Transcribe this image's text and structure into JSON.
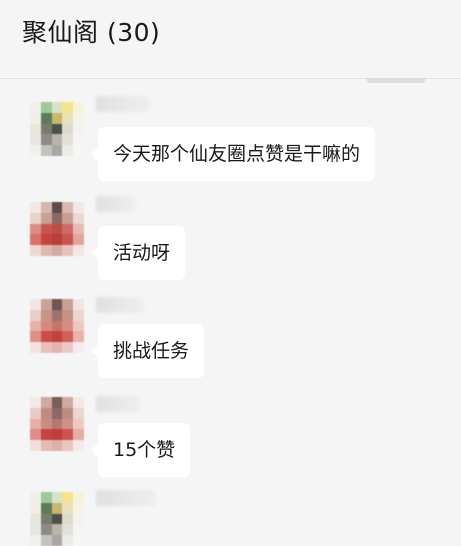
{
  "chat": {
    "title": "聚仙阁 (30)"
  },
  "messages": [
    {
      "text": "今天那个仙友圈点赞是干嘛的",
      "avatar_colors": [
        "#f0f0e8",
        "#9ec99a",
        "#d8e2c8",
        "#f4e48a",
        "#f7f3d8",
        "#f0efe6",
        "#5c7c58",
        "#c9b76c",
        "#e8e2bc",
        "#f5f3e8",
        "#e9e6dc",
        "#7a7b6e",
        "#4c4f4a",
        "#dedad0",
        "#f3f2ee",
        "#e6e6e0",
        "#8d8b84",
        "#b8b4aa",
        "#e2e0da",
        "#f4f4f2",
        "#f0f0ee",
        "#c4c2bc",
        "#a9a7a1",
        "#ecebe8",
        "#f6f6f6"
      ]
    },
    {
      "text": "活动呀",
      "avatar_colors": [
        "#f1e7e3",
        "#d5b7ad",
        "#5e4a48",
        "#d8b8b0",
        "#f2e9e6",
        "#e7d2cc",
        "#c9a096",
        "#8a6a62",
        "#c89d92",
        "#ead8d3",
        "#d98d86",
        "#c8564e",
        "#c04b45",
        "#cf6a62",
        "#e7bab4",
        "#d9706a",
        "#c7443e",
        "#b93f3a",
        "#c9544d",
        "#e2a49e",
        "#eed6d2",
        "#e0b8b2",
        "#d6a8a2",
        "#e6c2bc",
        "#f3e6e3"
      ]
    },
    {
      "text": "挑战任务",
      "avatar_colors": [
        "#f2e6e2",
        "#caa298",
        "#6e5652",
        "#c8a096",
        "#f1e5e1",
        "#e7cfc8",
        "#c89488",
        "#9a7468",
        "#c69284",
        "#ebd6d0",
        "#e5b2a8",
        "#d8887c",
        "#c97468",
        "#d88c82",
        "#ecc8c0",
        "#df8e88",
        "#cc4c46",
        "#c2433e",
        "#d0605a",
        "#e8b2ac",
        "#f3e2df",
        "#e7c0bb",
        "#e1b6b0",
        "#ebcac5",
        "#f6ebe9"
      ]
    },
    {
      "text": "15个赞",
      "avatar_colors": [
        "#f3e9e6",
        "#cfaaa1",
        "#7a5d57",
        "#cfa99f",
        "#f3e8e5",
        "#e6cdc6",
        "#c08a80",
        "#8a6a62",
        "#bf8c82",
        "#ebd5cf",
        "#e4b0a7",
        "#c98c82",
        "#b7776e",
        "#cd9289",
        "#ecc9c2",
        "#dd8d86",
        "#c8433d",
        "#bf3e39",
        "#cb544e",
        "#e6aca6",
        "#f2dedb",
        "#e5bbb6",
        "#dfb0aa",
        "#e9c6c1",
        "#f5e9e7"
      ]
    },
    {
      "text": "",
      "avatar_colors": [
        "#f0f0e8",
        "#9ec99a",
        "#d8e2c8",
        "#f4e48a",
        "#f7f3d8",
        "#f0efe6",
        "#5c7c58",
        "#c9b76c",
        "#e8e2bc",
        "#f5f3e8",
        "#e9e6dc",
        "#7a7b6e",
        "#4c4f4a",
        "#dedad0",
        "#f3f2ee",
        "#e6e6e0",
        "#8d8b84",
        "#b8b4aa",
        "#e2e0da",
        "#f4f4f2",
        "#f0f0ee",
        "#c4c2bc",
        "#a9a7a1",
        "#ecebe8",
        "#f6f6f6"
      ]
    }
  ]
}
